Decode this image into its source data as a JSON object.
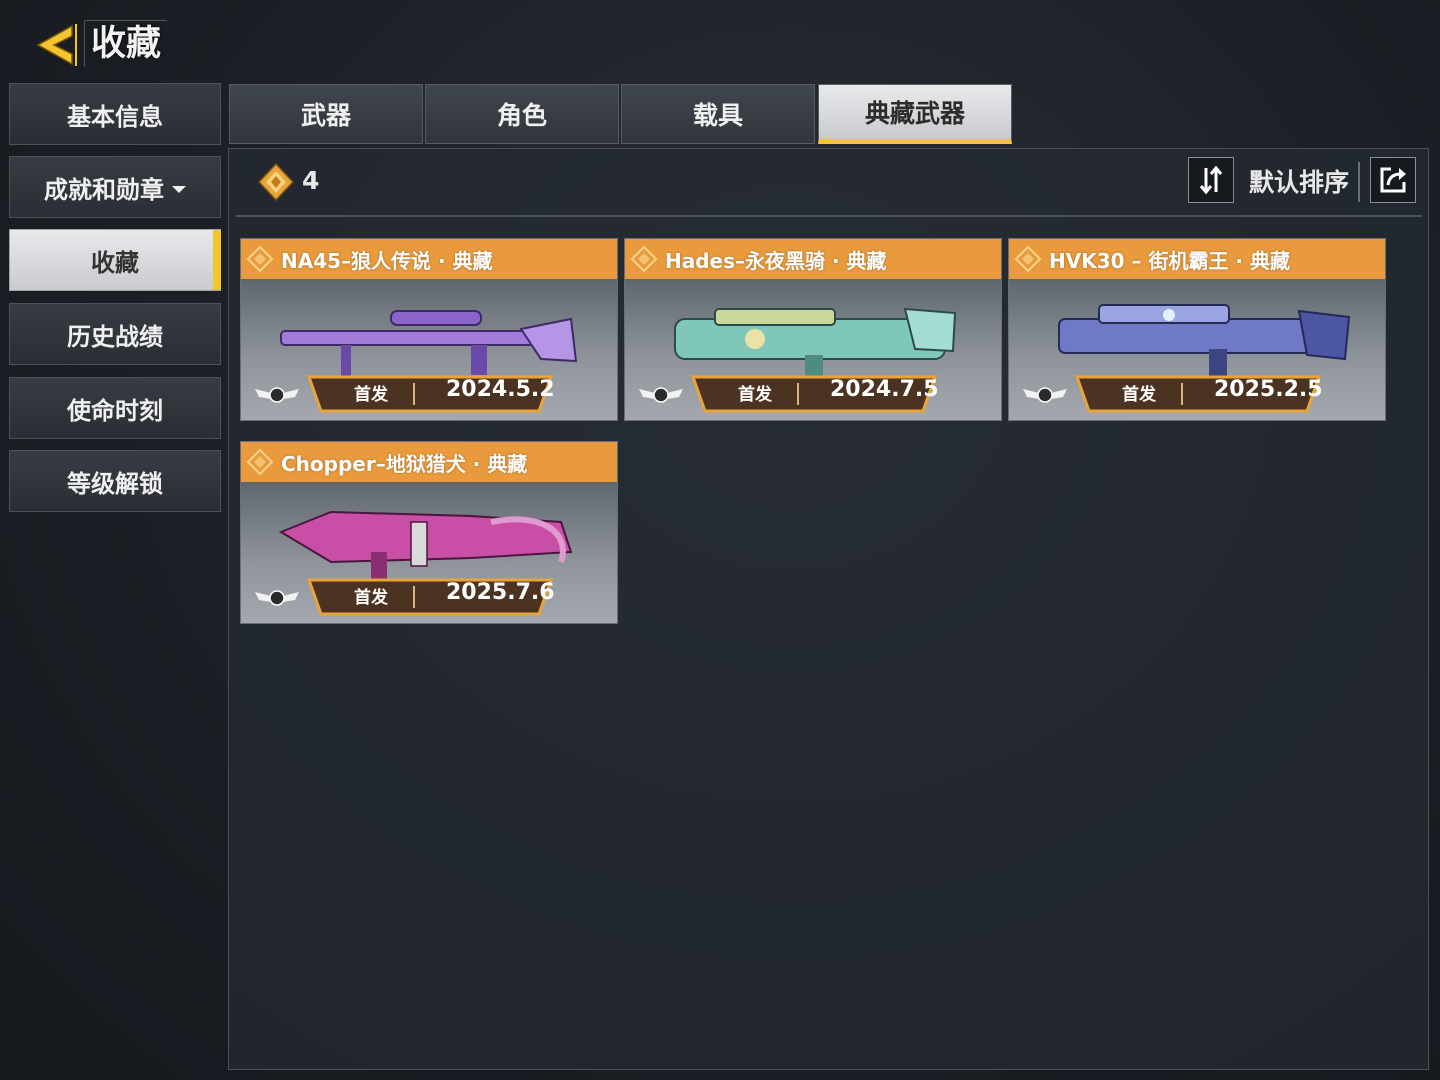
{
  "header": {
    "title": "收藏",
    "back_icon": "back-arrow-icon",
    "accent": "#f5c431"
  },
  "sidebar": {
    "items": [
      {
        "label": "基本信息"
      },
      {
        "label": "成就和勋章",
        "has_dropdown": true
      },
      {
        "label": "收藏",
        "active": true
      },
      {
        "label": "历史战绩"
      },
      {
        "label": "使命时刻"
      },
      {
        "label": "等级解锁"
      }
    ]
  },
  "tabs": [
    {
      "label": "武器"
    },
    {
      "label": "角色"
    },
    {
      "label": "载具"
    },
    {
      "label": "典藏武器",
      "active": true
    }
  ],
  "toolbar": {
    "count": "4",
    "count_icon": "collection-diamond-icon",
    "sort_icon": "sort-toggle-icon",
    "sort_label": "默认排序",
    "share_icon": "share-icon"
  },
  "cards": [
    {
      "name": "NA45–狼人传说 · 典藏",
      "badge": "首发",
      "date": "2024.5.2",
      "gun_color": "#a27ad8"
    },
    {
      "name": "Hades–永夜黑骑 · 典藏",
      "badge": "首发",
      "date": "2024.7.5",
      "gun_color": "#7fc7b9"
    },
    {
      "name": "HVK30 – 街机霸王 · 典藏",
      "badge": "首发",
      "date": "2025.2.5",
      "gun_color": "#6f79c8"
    },
    {
      "name": "Chopper–地狱猎犬 · 典藏",
      "badge": "首发",
      "date": "2025.7.6",
      "gun_color": "#c94fa6"
    }
  ],
  "colors": {
    "card_header": "#e89a3c",
    "active_tab_underline": "#f5c431"
  }
}
